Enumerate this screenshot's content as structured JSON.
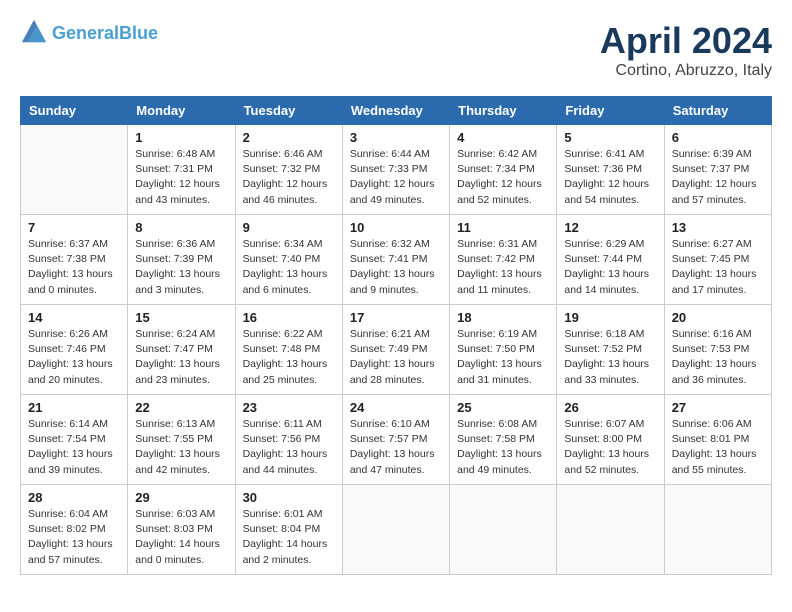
{
  "header": {
    "logo_line1": "General",
    "logo_line2": "Blue",
    "title": "April 2024",
    "subtitle": "Cortino, Abruzzo, Italy"
  },
  "weekdays": [
    "Sunday",
    "Monday",
    "Tuesday",
    "Wednesday",
    "Thursday",
    "Friday",
    "Saturday"
  ],
  "weeks": [
    [
      {
        "day": "",
        "info": ""
      },
      {
        "day": "1",
        "info": "Sunrise: 6:48 AM\nSunset: 7:31 PM\nDaylight: 12 hours\nand 43 minutes."
      },
      {
        "day": "2",
        "info": "Sunrise: 6:46 AM\nSunset: 7:32 PM\nDaylight: 12 hours\nand 46 minutes."
      },
      {
        "day": "3",
        "info": "Sunrise: 6:44 AM\nSunset: 7:33 PM\nDaylight: 12 hours\nand 49 minutes."
      },
      {
        "day": "4",
        "info": "Sunrise: 6:42 AM\nSunset: 7:34 PM\nDaylight: 12 hours\nand 52 minutes."
      },
      {
        "day": "5",
        "info": "Sunrise: 6:41 AM\nSunset: 7:36 PM\nDaylight: 12 hours\nand 54 minutes."
      },
      {
        "day": "6",
        "info": "Sunrise: 6:39 AM\nSunset: 7:37 PM\nDaylight: 12 hours\nand 57 minutes."
      }
    ],
    [
      {
        "day": "7",
        "info": "Sunrise: 6:37 AM\nSunset: 7:38 PM\nDaylight: 13 hours\nand 0 minutes."
      },
      {
        "day": "8",
        "info": "Sunrise: 6:36 AM\nSunset: 7:39 PM\nDaylight: 13 hours\nand 3 minutes."
      },
      {
        "day": "9",
        "info": "Sunrise: 6:34 AM\nSunset: 7:40 PM\nDaylight: 13 hours\nand 6 minutes."
      },
      {
        "day": "10",
        "info": "Sunrise: 6:32 AM\nSunset: 7:41 PM\nDaylight: 13 hours\nand 9 minutes."
      },
      {
        "day": "11",
        "info": "Sunrise: 6:31 AM\nSunset: 7:42 PM\nDaylight: 13 hours\nand 11 minutes."
      },
      {
        "day": "12",
        "info": "Sunrise: 6:29 AM\nSunset: 7:44 PM\nDaylight: 13 hours\nand 14 minutes."
      },
      {
        "day": "13",
        "info": "Sunrise: 6:27 AM\nSunset: 7:45 PM\nDaylight: 13 hours\nand 17 minutes."
      }
    ],
    [
      {
        "day": "14",
        "info": "Sunrise: 6:26 AM\nSunset: 7:46 PM\nDaylight: 13 hours\nand 20 minutes."
      },
      {
        "day": "15",
        "info": "Sunrise: 6:24 AM\nSunset: 7:47 PM\nDaylight: 13 hours\nand 23 minutes."
      },
      {
        "day": "16",
        "info": "Sunrise: 6:22 AM\nSunset: 7:48 PM\nDaylight: 13 hours\nand 25 minutes."
      },
      {
        "day": "17",
        "info": "Sunrise: 6:21 AM\nSunset: 7:49 PM\nDaylight: 13 hours\nand 28 minutes."
      },
      {
        "day": "18",
        "info": "Sunrise: 6:19 AM\nSunset: 7:50 PM\nDaylight: 13 hours\nand 31 minutes."
      },
      {
        "day": "19",
        "info": "Sunrise: 6:18 AM\nSunset: 7:52 PM\nDaylight: 13 hours\nand 33 minutes."
      },
      {
        "day": "20",
        "info": "Sunrise: 6:16 AM\nSunset: 7:53 PM\nDaylight: 13 hours\nand 36 minutes."
      }
    ],
    [
      {
        "day": "21",
        "info": "Sunrise: 6:14 AM\nSunset: 7:54 PM\nDaylight: 13 hours\nand 39 minutes."
      },
      {
        "day": "22",
        "info": "Sunrise: 6:13 AM\nSunset: 7:55 PM\nDaylight: 13 hours\nand 42 minutes."
      },
      {
        "day": "23",
        "info": "Sunrise: 6:11 AM\nSunset: 7:56 PM\nDaylight: 13 hours\nand 44 minutes."
      },
      {
        "day": "24",
        "info": "Sunrise: 6:10 AM\nSunset: 7:57 PM\nDaylight: 13 hours\nand 47 minutes."
      },
      {
        "day": "25",
        "info": "Sunrise: 6:08 AM\nSunset: 7:58 PM\nDaylight: 13 hours\nand 49 minutes."
      },
      {
        "day": "26",
        "info": "Sunrise: 6:07 AM\nSunset: 8:00 PM\nDaylight: 13 hours\nand 52 minutes."
      },
      {
        "day": "27",
        "info": "Sunrise: 6:06 AM\nSunset: 8:01 PM\nDaylight: 13 hours\nand 55 minutes."
      }
    ],
    [
      {
        "day": "28",
        "info": "Sunrise: 6:04 AM\nSunset: 8:02 PM\nDaylight: 13 hours\nand 57 minutes."
      },
      {
        "day": "29",
        "info": "Sunrise: 6:03 AM\nSunset: 8:03 PM\nDaylight: 14 hours\nand 0 minutes."
      },
      {
        "day": "30",
        "info": "Sunrise: 6:01 AM\nSunset: 8:04 PM\nDaylight: 14 hours\nand 2 minutes."
      },
      {
        "day": "",
        "info": ""
      },
      {
        "day": "",
        "info": ""
      },
      {
        "day": "",
        "info": ""
      },
      {
        "day": "",
        "info": ""
      }
    ]
  ]
}
